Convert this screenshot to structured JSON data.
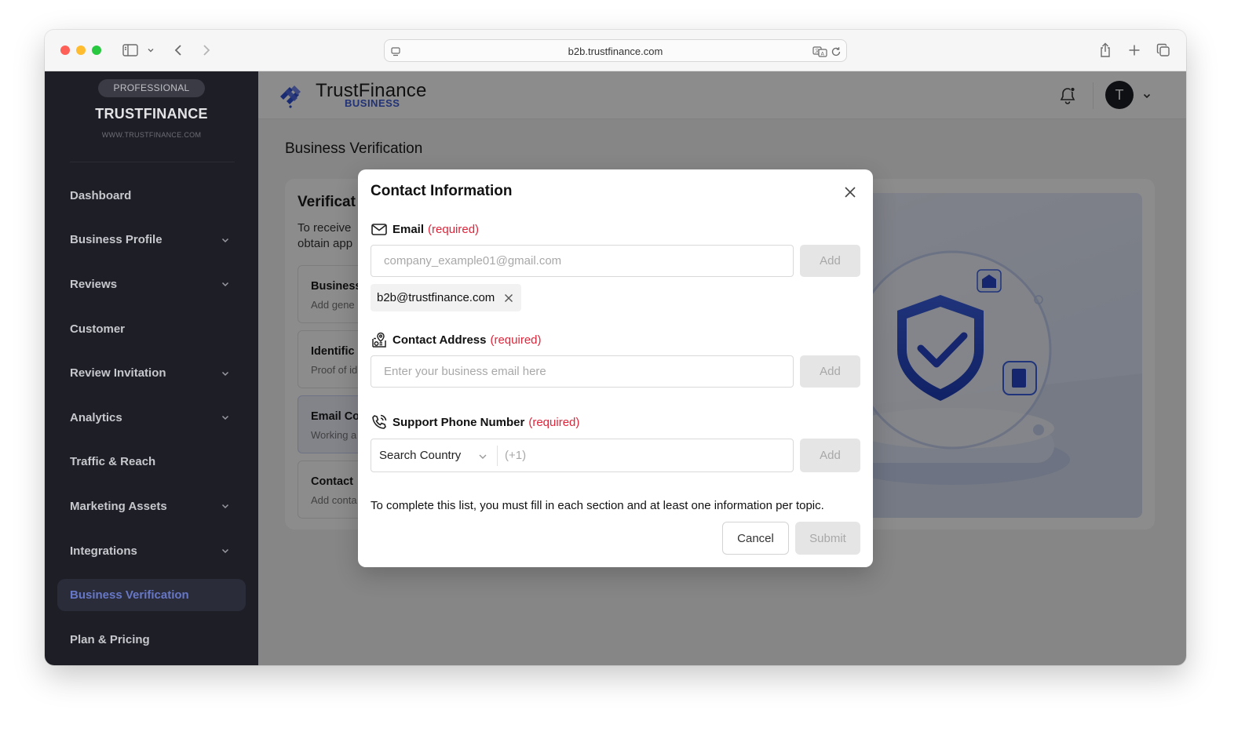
{
  "browser": {
    "url": "b2b.trustfinance.com",
    "icons": [
      "sidebar-toggle-icon",
      "chevron-down-icon",
      "back-icon",
      "forward-icon",
      "site-icon",
      "translate-icon",
      "reload-icon",
      "share-icon",
      "new-tab-icon",
      "tab-overview-icon"
    ]
  },
  "sidebar": {
    "plan_badge": "PROFESSIONAL",
    "brand_name": "TRUSTFINANCE",
    "brand_url": "WWW.TRUSTFINANCE.COM",
    "items": [
      {
        "label": "Dashboard",
        "has_submenu": false,
        "active": false
      },
      {
        "label": "Business Profile",
        "has_submenu": true,
        "active": false
      },
      {
        "label": "Reviews",
        "has_submenu": true,
        "active": false
      },
      {
        "label": "Customer",
        "has_submenu": false,
        "active": false
      },
      {
        "label": "Review Invitation",
        "has_submenu": true,
        "active": false
      },
      {
        "label": "Analytics",
        "has_submenu": true,
        "active": false
      },
      {
        "label": "Traffic & Reach",
        "has_submenu": false,
        "active": false
      },
      {
        "label": "Marketing Assets",
        "has_submenu": true,
        "active": false
      },
      {
        "label": "Integrations",
        "has_submenu": true,
        "active": false
      },
      {
        "label": "Business Verification",
        "has_submenu": false,
        "active": true
      },
      {
        "label": "Plan & Pricing",
        "has_submenu": false,
        "active": false
      }
    ]
  },
  "header": {
    "logo_title": "TrustFinance",
    "logo_subtitle": "BUSINESS",
    "avatar_initial": "T"
  },
  "page": {
    "title": "Business Verification",
    "panel_title": "Verificat",
    "panel_desc_lines": [
      "To receive",
      "obtain app"
    ],
    "steps": [
      {
        "title": "Business",
        "subtitle": "Add gene",
        "selected": false
      },
      {
        "title": "Identific",
        "subtitle": "Proof of id",
        "selected": false
      },
      {
        "title": "Email Co",
        "subtitle": "Working a",
        "selected": true
      },
      {
        "title": "Contact",
        "subtitle": "Add conta",
        "selected": false
      }
    ]
  },
  "modal": {
    "title": "Contact Information",
    "required_text": "(required)",
    "email": {
      "label": "Email",
      "placeholder": "company_example01@gmail.com",
      "value": "",
      "add_label": "Add",
      "chip": "b2b@trustfinance.com"
    },
    "address": {
      "label": "Contact Address",
      "placeholder": "Enter your business email here",
      "value": "",
      "add_label": "Add"
    },
    "phone": {
      "label": "Support Phone Number",
      "country_placeholder": "Search Country",
      "code_placeholder": "(+1)",
      "add_label": "Add"
    },
    "hint": "To complete this list, you must fill in each section and at least one information per topic.",
    "cancel_label": "Cancel",
    "submit_label": "Submit"
  },
  "colors": {
    "sidebar_bg": "#1d1e26",
    "active_nav": "#6777c7",
    "brand_blue": "#3c5bd8",
    "required_red": "#e0243a",
    "disabled_button": "#e5e5e5"
  }
}
